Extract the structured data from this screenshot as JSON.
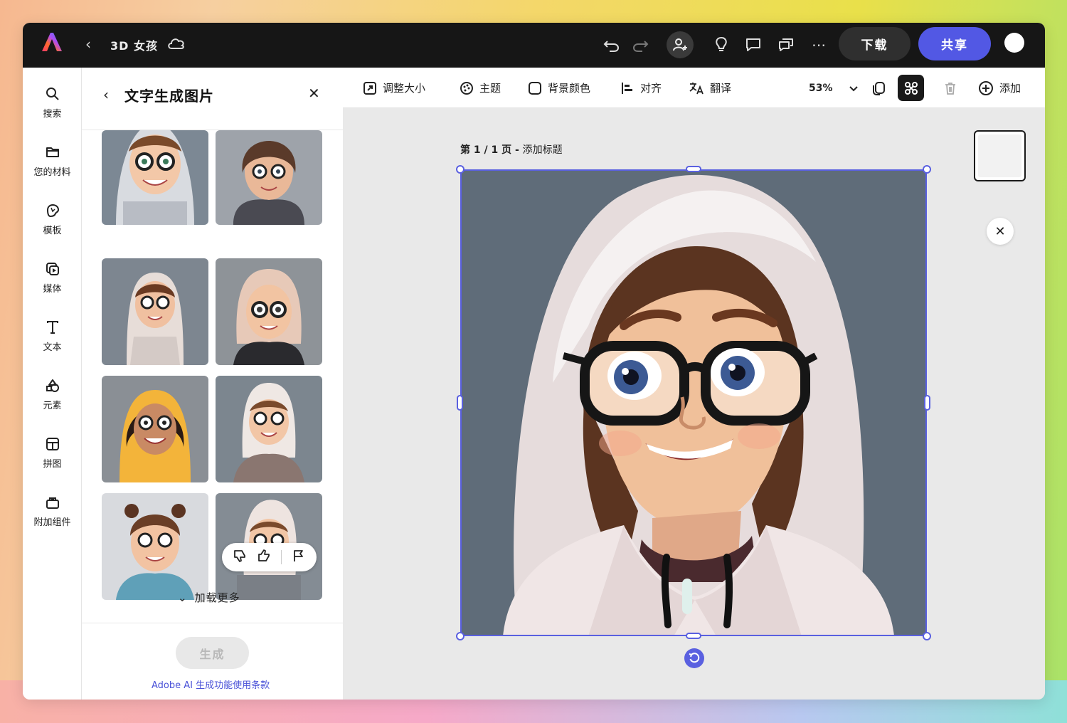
{
  "topbar": {
    "doc_title": "3D 女孩",
    "download_label": "下载",
    "share_label": "共享"
  },
  "rail": {
    "items": [
      {
        "label": "搜索",
        "icon": "search-icon"
      },
      {
        "label": "您的材料",
        "icon": "folder-icon"
      },
      {
        "label": "模板",
        "icon": "templates-icon"
      },
      {
        "label": "媒体",
        "icon": "media-icon"
      },
      {
        "label": "文本",
        "icon": "text-icon"
      },
      {
        "label": "元素",
        "icon": "elements-icon"
      },
      {
        "label": "拼图",
        "icon": "grid-icon"
      },
      {
        "label": "附加组件",
        "icon": "addons-icon"
      }
    ]
  },
  "panel": {
    "title": "文字生成图片",
    "load_more": "加载更多",
    "generate_label": "生成",
    "terms_link": "Adobe AI 生成功能使用条款"
  },
  "toolbar": {
    "resize": "调整大小",
    "theme": "主题",
    "bg_color": "背景颜色",
    "align": "对齐",
    "translate": "翻译",
    "zoom": "53%",
    "add": "添加"
  },
  "canvas": {
    "page_prefix": "第 1 / 1 页 - ",
    "page_title": "添加标题"
  },
  "colors": {
    "accent": "#5258e4",
    "topbar": "#161616",
    "selection": "#5a60e0"
  }
}
